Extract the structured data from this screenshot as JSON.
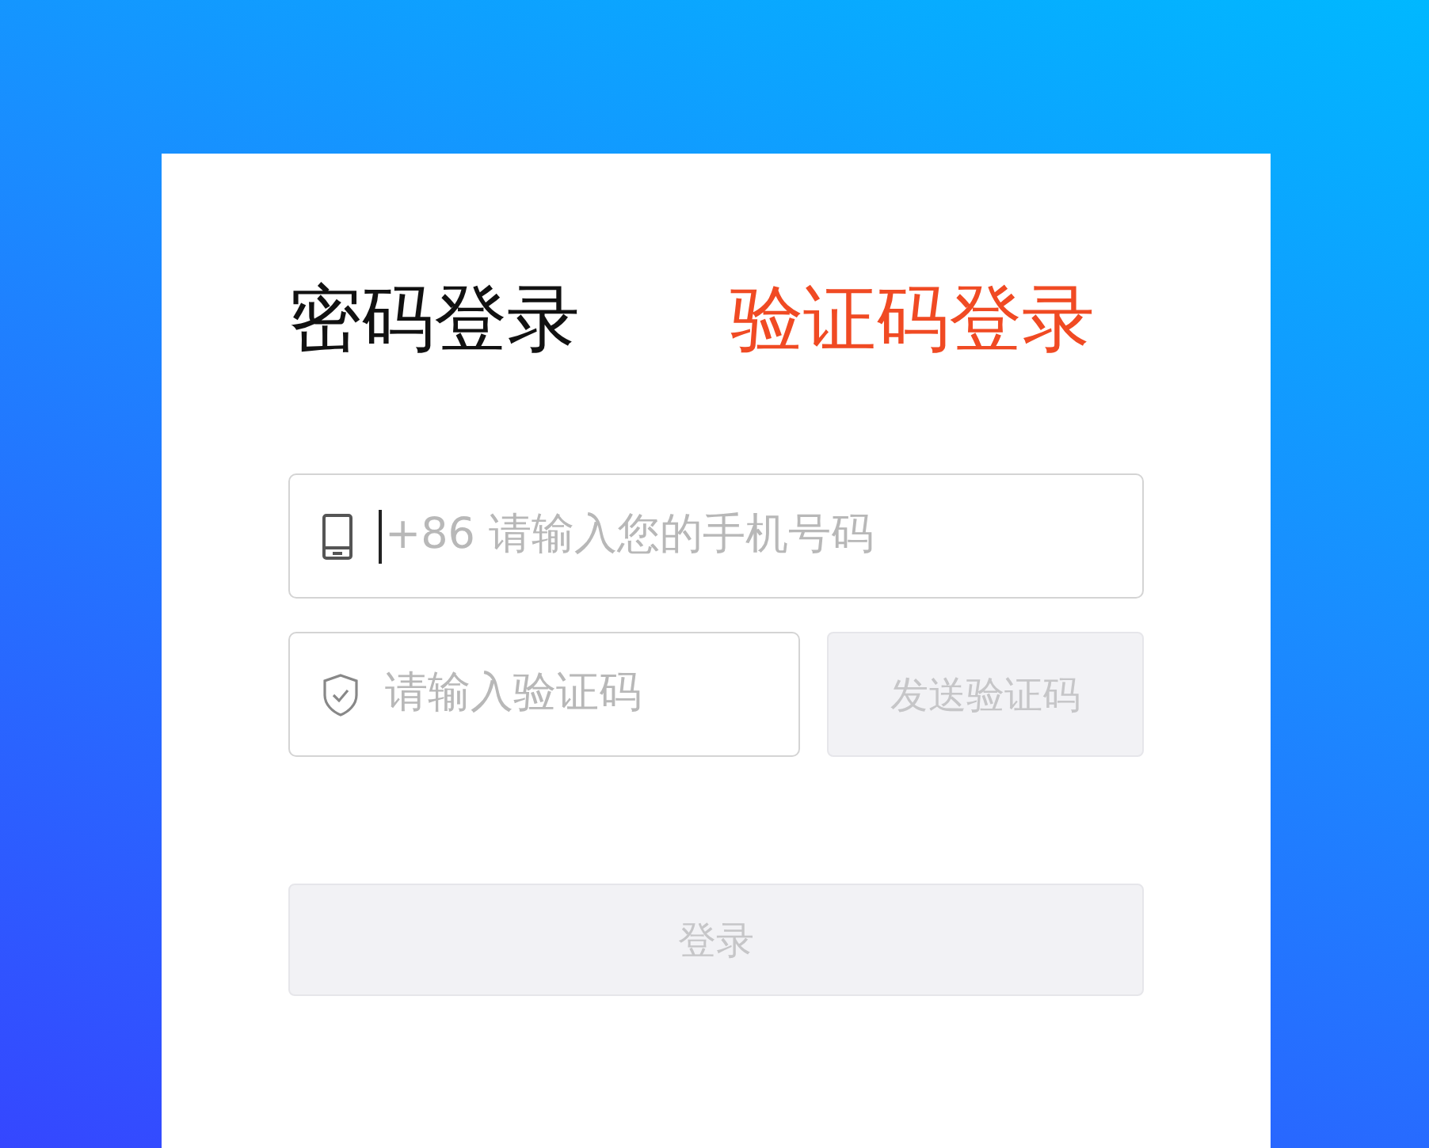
{
  "tabs": [
    {
      "label": "密码登录",
      "selected": false
    },
    {
      "label": "验证码登录",
      "selected": true
    }
  ],
  "phone_field": {
    "placeholder": "+86 请输入您的手机号码",
    "focused": true
  },
  "code_field": {
    "placeholder": "请输入验证码"
  },
  "send_code_button": {
    "label": "发送验证码",
    "disabled": true
  },
  "login_button": {
    "label": "登录",
    "disabled": true
  }
}
